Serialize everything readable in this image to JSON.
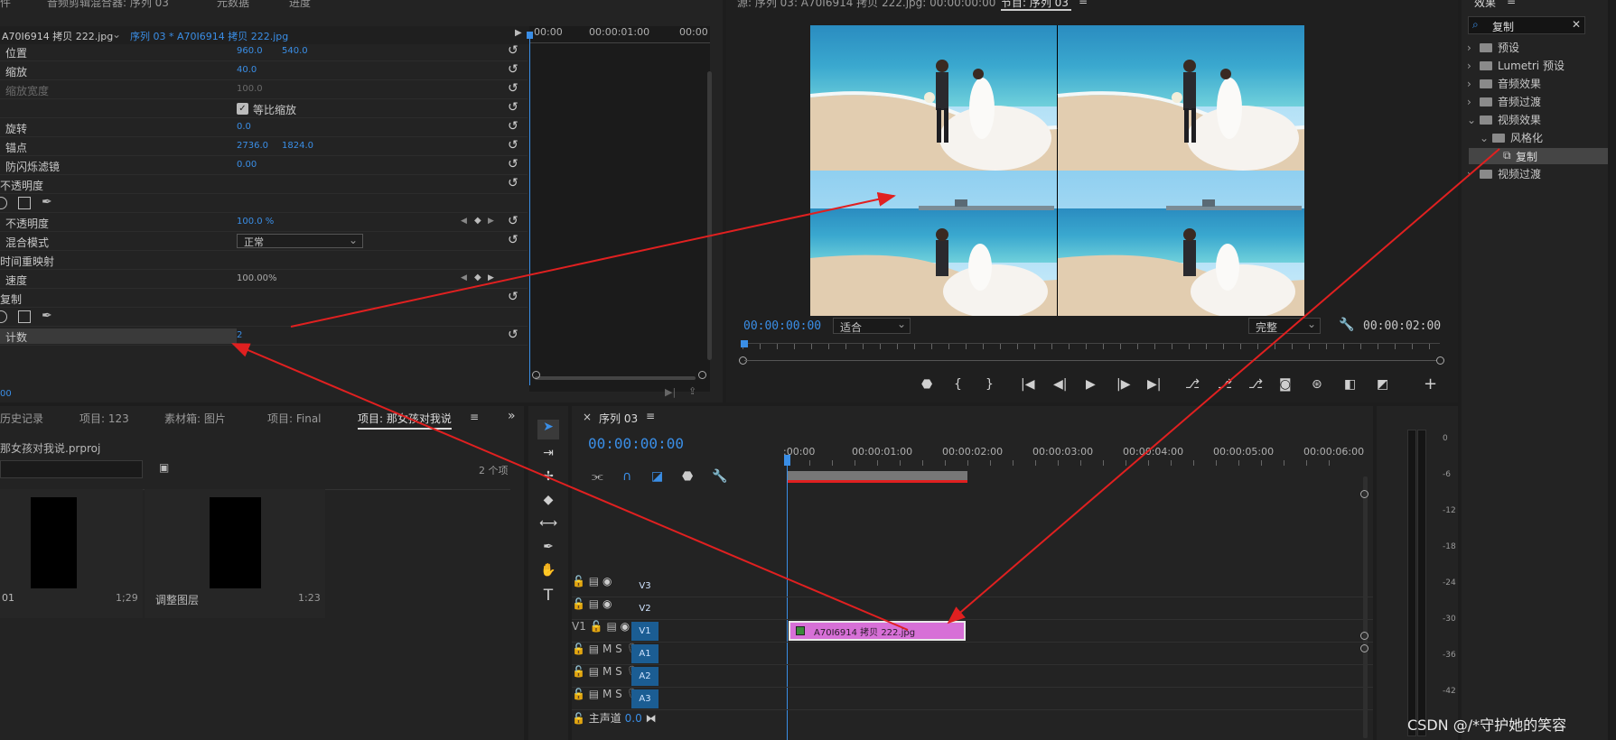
{
  "effect_controls": {
    "top_tabs": [
      "件",
      "音频剪辑混合器: 序列 03",
      "元数据",
      "进度"
    ],
    "clip_path": "A70I6914 拷贝 222.jpg",
    "seq_clip": "序列 03 * A70I6914 拷贝 222.jpg",
    "ruler": [
      "00:00",
      "00:00:01:00",
      "00:00"
    ],
    "rows": [
      {
        "label": "位置",
        "v1": "960.0",
        "v2": "540.0"
      },
      {
        "label": "缩放",
        "v1": "40.0"
      },
      {
        "label": "缩放宽度",
        "v1": "100.0"
      },
      {
        "label": "等比缩放"
      },
      {
        "label": "旋转",
        "v1": "0.0"
      },
      {
        "label": "锚点",
        "v1": "2736.0",
        "v2": "1824.0"
      },
      {
        "label": "防闪烁滤镜",
        "v1": "0.00"
      },
      {
        "label": "不透明度"
      },
      {
        "label": ""
      },
      {
        "label": "不透明度",
        "v1": "100.0 %"
      },
      {
        "label": "混合模式",
        "v1": "正常"
      },
      {
        "label": "时间重映射"
      },
      {
        "label": "速度",
        "v1": "100.00%"
      },
      {
        "label": "复制"
      },
      {
        "label": ""
      },
      {
        "label": "计数",
        "v1": "2"
      }
    ],
    "bottom_time": "00"
  },
  "source_monitor": {
    "title": "源: 序列 03: A70I6914 拷贝 222.jpg: 00:00:00:00"
  },
  "program_monitor": {
    "tab": "节目: 序列 03",
    "timecode": "00:00:00:00",
    "fit": "适合",
    "quality": "完整",
    "duration": "00:00:02:00"
  },
  "effects": {
    "tab": "效果",
    "search_value": "复制",
    "items": [
      {
        "label": "预设",
        "arrow": "›"
      },
      {
        "label": "Lumetri 预设",
        "arrow": "›"
      },
      {
        "label": "音频效果",
        "arrow": "›"
      },
      {
        "label": "音频过渡",
        "arrow": "›"
      },
      {
        "label": "视频效果",
        "arrow": "⌄"
      },
      {
        "label": "风格化",
        "arrow": "⌄"
      },
      {
        "label": "复制",
        "arrow": ""
      },
      {
        "label": "视频过渡",
        "arrow": "›"
      }
    ]
  },
  "project": {
    "tabs": [
      "历史记录",
      "项目: 123",
      "素材箱: 图片",
      "项目: Final",
      "项目: 那女孩对我说"
    ],
    "file": "那女孩对我说.prproj",
    "count": "2 个项",
    "items": [
      {
        "name": "01",
        "duration": "1;29"
      },
      {
        "name": "调整图层",
        "duration": "1:23"
      }
    ]
  },
  "timeline": {
    "tab": "序列 03",
    "timecode": "00:00:00:00",
    "ruler": [
      ":00:00",
      "00:00:01:00",
      "00:00:02:00",
      "00:00:03:00",
      "00:00:04:00",
      "00:00:05:00",
      "00:00:06:00"
    ],
    "tracks": [
      {
        "src": "",
        "name": "V3",
        "kind": "video",
        "target": false
      },
      {
        "src": "",
        "name": "V2",
        "kind": "video",
        "target": false
      },
      {
        "src": "V1",
        "name": "V1",
        "kind": "video",
        "target": true
      },
      {
        "src": "",
        "name": "A1",
        "kind": "audio",
        "target": true
      },
      {
        "src": "",
        "name": "A2",
        "kind": "audio",
        "target": true
      },
      {
        "src": "",
        "name": "A3",
        "kind": "audio",
        "target": true
      }
    ],
    "master_label": "主声道",
    "master_value": "0.0",
    "clip_name": "A70I6914 拷贝 222.jpg",
    "track_buttons": {
      "mute": "M",
      "solo": "S"
    }
  },
  "meter": {
    "labels": [
      "0",
      "-6",
      "-12",
      "-18",
      "-24",
      "-30",
      "-36",
      "-42"
    ]
  },
  "watermark": "CSDN @/*守护她的笑容",
  "colors": {
    "accent": "#3a8ee6",
    "clip": "#d770d7",
    "arrow": "#e02020"
  }
}
